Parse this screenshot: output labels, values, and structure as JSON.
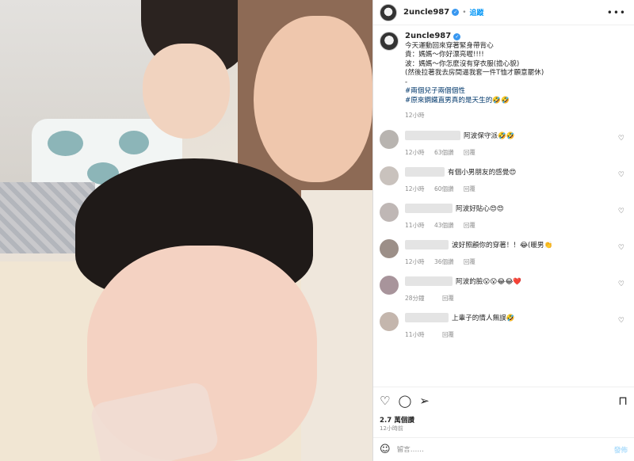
{
  "post": {
    "username": "2uncle987",
    "verified_mark": "✓",
    "separator": "•",
    "follow_label": "追蹤",
    "more_icon": "more-horizontal-icon",
    "caption_lines": [
      "今天運動回來穿著緊身帶背心",
      "貴：媽媽～你好漂亮喔!!!!",
      "波：媽媽～你怎麼沒有穿衣服(擔心貌)",
      "(然後拉著我去房間逼我套一件T恤才願意罷休)",
      "-"
    ],
    "hashtags": [
      "#兩個兒子兩個個性",
      "#原來鋼鐵直男真的是天生的🤣🤣"
    ],
    "caption_time": "12小時"
  },
  "comments": [
    {
      "text": "阿波保守派🤣🤣",
      "time": "12小時",
      "likes": "63個讚",
      "reply": "回覆",
      "blur_w": 70,
      "avatar": "#b8b4b0"
    },
    {
      "text": "有個小男朋友的感覺😍",
      "time": "12小時",
      "likes": "60個讚",
      "reply": "回覆",
      "blur_w": 50,
      "avatar": "#c9c2bd"
    },
    {
      "text": "阿波好貼心😍😍",
      "time": "11小時",
      "likes": "43個讚",
      "reply": "回覆",
      "blur_w": 60,
      "avatar": "#bfb7b5"
    },
    {
      "text": "波好照顧你的穿著！！😂(暖男👏",
      "time": "12小時",
      "likes": "36個讚",
      "reply": "回覆",
      "blur_w": 55,
      "avatar": "#9c8f88"
    },
    {
      "text": "阿波的臉😮😮😂😂❤️",
      "time": "28分鐘",
      "likes": "",
      "reply": "回覆",
      "blur_w": 60,
      "avatar": "#a8949b"
    },
    {
      "text": "上輩子的情人無誤🤣",
      "time": "11小時",
      "likes": "",
      "reply": "回覆",
      "blur_w": 55,
      "avatar": "#c4b6ad"
    }
  ],
  "actions": {
    "like_icon": "heart-icon",
    "comment_icon": "comment-icon",
    "share_icon": "share-icon",
    "save_icon": "bookmark-icon",
    "likes_text": "2.7 萬個讚",
    "time_text": "12小時前"
  },
  "composer": {
    "placeholder": "留言……",
    "post_label": "發佈",
    "emoji_icon": "smiley-icon"
  },
  "comment_heart_icon": "small-heart-icon"
}
